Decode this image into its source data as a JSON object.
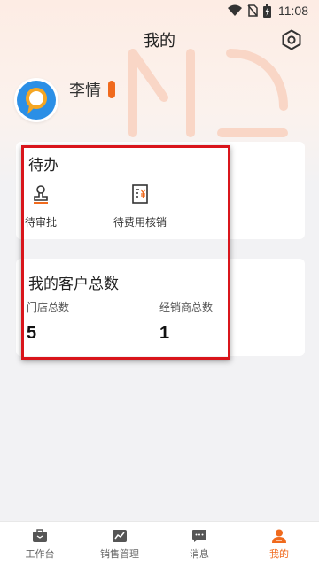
{
  "status_bar": {
    "time": "11:08"
  },
  "header": {
    "title": "我的"
  },
  "profile": {
    "name": "李情"
  },
  "todo": {
    "title": "待办",
    "items": [
      {
        "label": "待审批",
        "icon": "stamp-icon"
      },
      {
        "label": "待费用核销",
        "icon": "expense-document-icon"
      }
    ]
  },
  "customers": {
    "title": "我的客户总数",
    "stats": [
      {
        "label": "门店总数",
        "value": "5"
      },
      {
        "label": "经销商总数",
        "value": "1"
      }
    ]
  },
  "bottom_nav": {
    "items": [
      {
        "label": "工作台",
        "icon": "workbench-icon"
      },
      {
        "label": "销售管理",
        "icon": "chart-icon"
      },
      {
        "label": "消息",
        "icon": "message-icon"
      },
      {
        "label": "我的",
        "icon": "profile-icon",
        "active": true
      }
    ]
  },
  "colors": {
    "accent": "#f06a1d",
    "highlight": "#d9151b",
    "avatar_blue": "#2b8fe6"
  }
}
